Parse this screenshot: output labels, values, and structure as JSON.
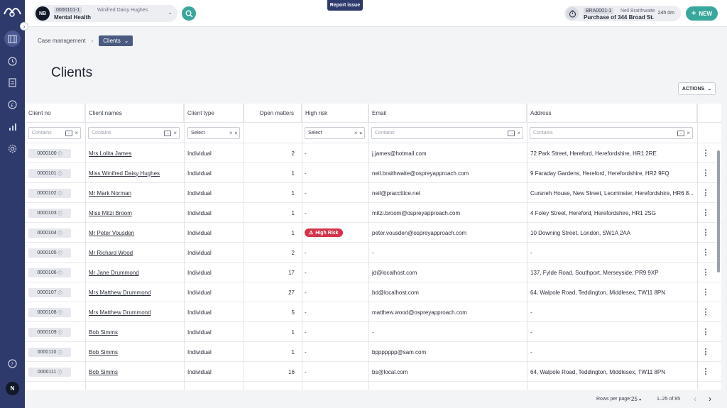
{
  "sidebar": {
    "user_initial": "N",
    "icons": [
      "matters-icon",
      "clock-icon",
      "tasks-icon",
      "pound-icon",
      "reports-icon",
      "settings-icon"
    ],
    "help_icon": "help-icon"
  },
  "topbar": {
    "matter": {
      "avatar": "NB",
      "number": "0000101-1",
      "client": "Winifred Daisy Hughes",
      "type": "Mental Health"
    },
    "report_issue": "Report issue",
    "timer": {
      "number": "BRA0001-1",
      "client": "Neil Braithwaite",
      "description": "Purchase of 344 Broad St.",
      "time": "24h 0m"
    },
    "new_label": "NEW"
  },
  "breadcrumb": {
    "parent": "Case management",
    "current": "Clients"
  },
  "page": {
    "title": "Clients",
    "actions_label": "ACTIONS"
  },
  "table": {
    "columns": [
      "Client no",
      "Client names",
      "Client type",
      "Open matters",
      "High risk",
      "Email",
      "Address"
    ],
    "filters": {
      "client_no": "Contains",
      "client_names": "Contains",
      "client_type": "Select",
      "high_risk": "Select",
      "email": "Contains",
      "address": "Contains"
    },
    "rows": [
      {
        "no": "0000100",
        "name": "Mrs Lolita James",
        "type": "Individual",
        "open": "2",
        "risk": "-",
        "email": "j.james@hotmail.com",
        "address": "72 Park Street, Hereford, Herefordshire, HR1 2RE"
      },
      {
        "no": "0000101",
        "name": "Miss Winifred Daisy Hughes",
        "type": "Individual",
        "open": "1",
        "risk": "-",
        "email": "neil.braithwaite@ospreyapproach.com",
        "address": "9 Faraday Gardens, Hereford, Herefordshire, HR2 9FQ"
      },
      {
        "no": "0000102",
        "name": "Mr Mark Norman",
        "type": "Individual",
        "open": "1",
        "risk": "-",
        "email": "neil@praccttice.net",
        "address": "Cursneh House, New Street, Leominster, Herefordshire, HR6 8..."
      },
      {
        "no": "0000103",
        "name": "Miss Mitzi Broom",
        "type": "Individual",
        "open": "1",
        "risk": "-",
        "email": "mitzi.broom@ospreyapproach.com",
        "address": "4 Foley Street, Hereford, Herefordshire, HR1 2SG"
      },
      {
        "no": "0000104",
        "name": "Mr Peter Vousden",
        "type": "Individual",
        "open": "1",
        "risk": "High Risk",
        "email": "peter.vousden@ospreyapproach.com",
        "address": "10 Downing Street, London, SW1A 2AA"
      },
      {
        "no": "0000105",
        "name": "Mr Richard Wood",
        "type": "Individual",
        "open": "2",
        "risk": "-",
        "email": "-",
        "address": "-"
      },
      {
        "no": "0000106",
        "name": "Mr Jane Drummond",
        "type": "Individual",
        "open": "17",
        "risk": "-",
        "email": "jd@localhost.com",
        "address": "137, Fylde Road, Southport, Merseyside, PR9 9XP"
      },
      {
        "no": "0000107",
        "name": "Mrs Matthew Drummond",
        "type": "Individual",
        "open": "27",
        "risk": "-",
        "email": "bd@localhost.com",
        "address": "64, Walpole Road, Teddington, Middlesex, TW11 8PN"
      },
      {
        "no": "0000108",
        "name": "Mrs Matthew Drummond",
        "type": "Individual",
        "open": "5",
        "risk": "-",
        "email": "matthew.wood@ospreyapproach.com",
        "address": "-"
      },
      {
        "no": "0000109",
        "name": "Bob Simms",
        "type": "Individual",
        "open": "1",
        "risk": "-",
        "email": "-",
        "address": "-"
      },
      {
        "no": "0000110",
        "name": "Bob Simms",
        "type": "Individual",
        "open": "1",
        "risk": "-",
        "email": "bppppppp@sam.com",
        "address": "-"
      },
      {
        "no": "0000111",
        "name": "Bob Simms",
        "type": "Individual",
        "open": "16",
        "risk": "-",
        "email": "bs@local.com",
        "address": "64, Walpole Road, Teddington, Middlesex, TW11 8PN"
      }
    ]
  },
  "footer": {
    "rows_per_page_label": "Rows per page:",
    "rows_per_page": "25",
    "range": "1–25 of 85"
  },
  "colors": {
    "sidebar": "#2d3a6b",
    "accent": "#3aa79c",
    "danger": "#d3344a"
  }
}
